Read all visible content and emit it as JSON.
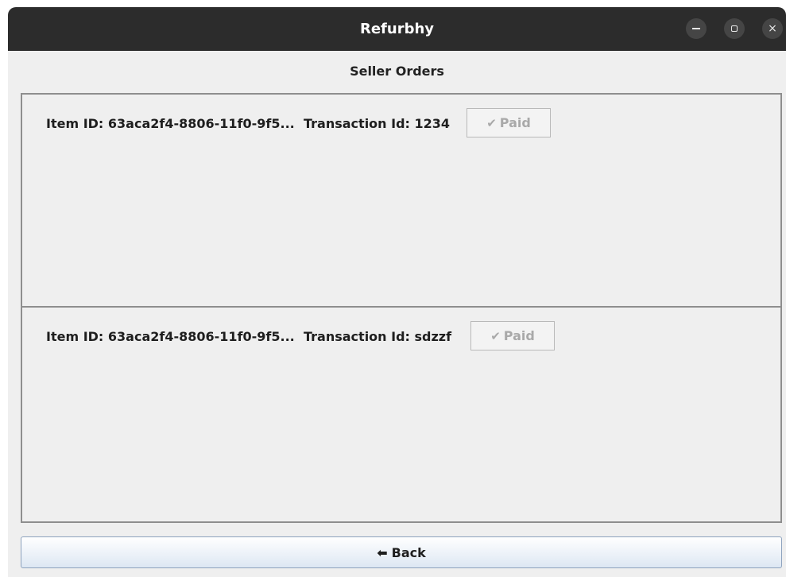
{
  "window": {
    "title": "Refurbhy",
    "controls": {
      "minimize": "minimize",
      "maximize": "maximize",
      "close": "×"
    }
  },
  "page": {
    "heading": "Seller Orders"
  },
  "orders": [
    {
      "item_id": "Item ID: 63aca2f4-8806-11f0-9f5...",
      "transaction": "Transaction Id: 1234",
      "status_label": "Paid",
      "status_icon": "✔"
    },
    {
      "item_id": "Item ID: 63aca2f4-8806-11f0-9f5...",
      "transaction": "Transaction Id: sdzzf",
      "status_label": "Paid",
      "status_icon": "✔"
    }
  ],
  "footer": {
    "back_label": "Back",
    "back_icon": "⬅"
  },
  "colors": {
    "titlebar": "#2c2c2c",
    "window_bg": "#efefef",
    "border": "#8e8e8e",
    "disabled_text": "#a9a9a9"
  }
}
